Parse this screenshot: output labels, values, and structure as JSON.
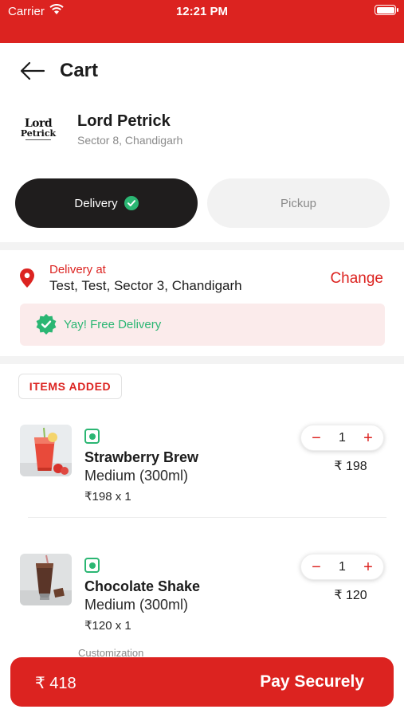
{
  "status_bar": {
    "carrier": "Carrier",
    "time": "12:21 PM"
  },
  "header": {
    "title": "Cart"
  },
  "restaurant": {
    "logo_line1": "Lord",
    "logo_line2": "Petrick",
    "name": "Lord Petrick",
    "address": "Sector 8, Chandigarh"
  },
  "mode_toggle": {
    "delivery_label": "Delivery",
    "pickup_label": "Pickup",
    "selected": "Delivery"
  },
  "delivery": {
    "label": "Delivery at",
    "address": "Test, Test, Sector 3, Chandigarh",
    "change_label": "Change",
    "free_delivery_text": "Yay! Free Delivery"
  },
  "items_section": {
    "badge": "ITEMS ADDED",
    "items": [
      {
        "name": "Strawberry Brew",
        "variant": "Medium (300ml)",
        "qty_price": "₹198 x 1",
        "quantity": "1",
        "total": "₹ 198",
        "thumb_icon": "strawberry-drink-image"
      },
      {
        "name": "Chocolate Shake",
        "variant": "Medium (300ml)",
        "qty_price": "₹120 x 1",
        "quantity": "1",
        "total": "₹ 120",
        "thumb_icon": "chocolate-shake-image"
      }
    ],
    "customization_label": "Customization"
  },
  "pay_bar": {
    "amount": "₹ 418",
    "label": "Pay Securely"
  },
  "colors": {
    "brand": "#dc2320",
    "success": "#2bb673",
    "dark": "#1f1d1d"
  }
}
